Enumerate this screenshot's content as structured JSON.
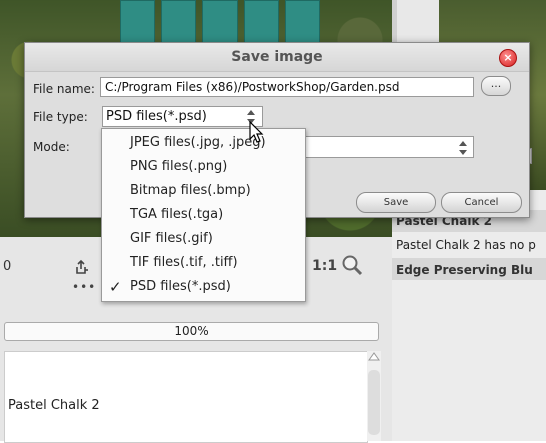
{
  "dialog": {
    "title": "Save image",
    "file_name_label": "File name:",
    "file_name_value": "C:/Program Files (x86)/PostworkShop/Garden.psd",
    "browse_label": "...",
    "file_type_label": "File type:",
    "file_type_value": "PSD files(*.psd)",
    "mode_label": "Mode:",
    "save_label": "Save",
    "cancel_label": "Cancel"
  },
  "file_type_options": [
    {
      "label": "JPEG files(.jpg, .jpeg)",
      "selected": false
    },
    {
      "label": "PNG files(.png)",
      "selected": false
    },
    {
      "label": "Bitmap files(.bmp)",
      "selected": false
    },
    {
      "label": "TGA files(.tga)",
      "selected": false
    },
    {
      "label": "GIF files(.gif)",
      "selected": false
    },
    {
      "label": "TIF files(.tif, .tiff)",
      "selected": false
    },
    {
      "label": "PSD files(*.psd)",
      "selected": true
    }
  ],
  "checkmark": "✓",
  "right_panel": {
    "layer_title_1": "Pastel Chalk 2",
    "layer_desc_1": "Pastel Chalk 2 has no p",
    "layer_title_2": "Edge Preserving Blu"
  },
  "toolbar": {
    "left_value": "0",
    "dots": "•••",
    "zoom_label": "1:1"
  },
  "progress": {
    "text": "100%",
    "fraction": 1.0
  },
  "layer_list": {
    "item_1": "Pastel Chalk 2"
  },
  "icons": {
    "close": "close-icon",
    "share": "share-icon",
    "magnifier": "magnifier-icon",
    "spinner": "spinner-arrows-icon",
    "scroll_up": "scroll-up-icon"
  },
  "colors": {
    "dialog_bg": "#dedede",
    "close_red": "#d62020",
    "panel_band": "#d7d7d7"
  }
}
